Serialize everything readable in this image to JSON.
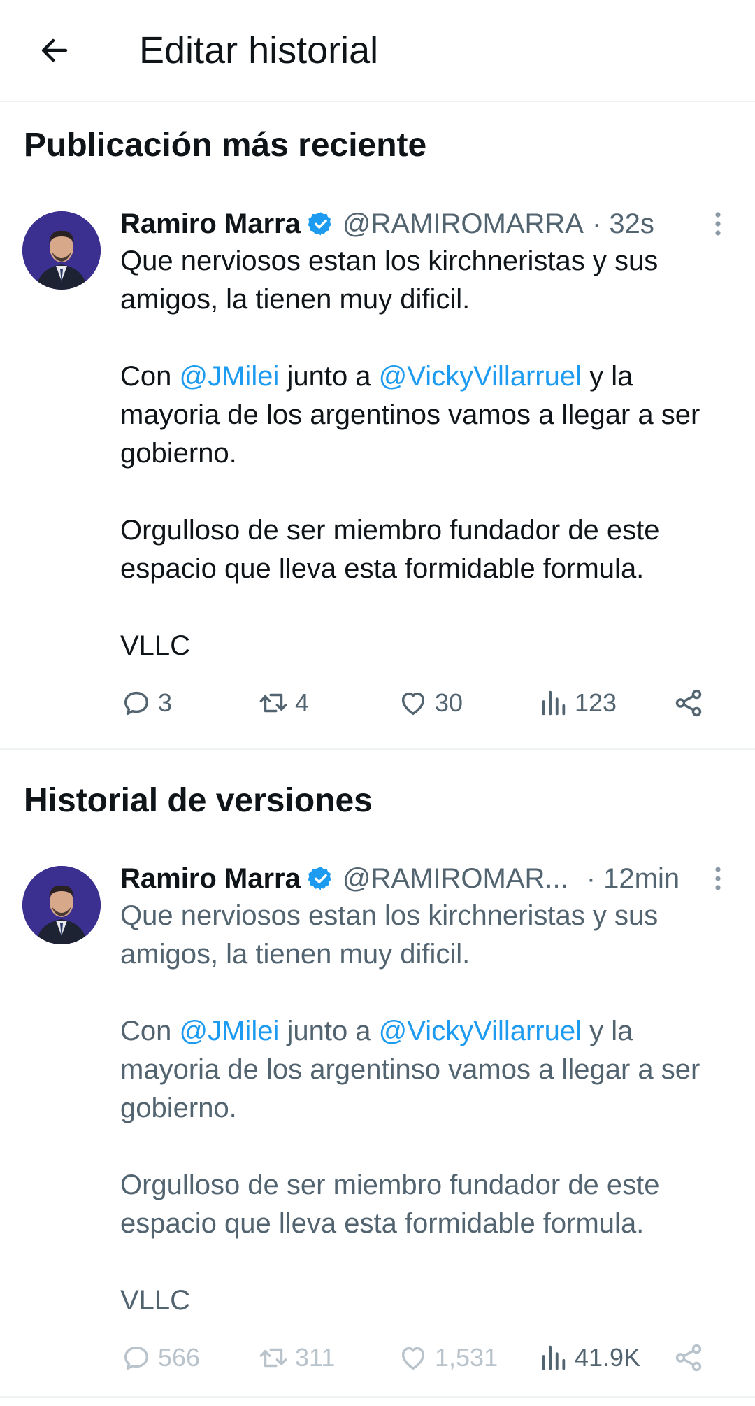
{
  "header": {
    "title": "Editar historial",
    "back_icon": "arrow-left-icon"
  },
  "sections": {
    "latest": "Publicación más reciente",
    "history": "Historial de versiones"
  },
  "posts": [
    {
      "author": "Ramiro Marra",
      "handle": "@RAMIROMARRA",
      "time": "· 32s",
      "lines": {
        "p1": "Que nerviosos estan los kirchneristas y sus amigos, la tienen muy dificil.",
        "p2_pre": "Con ",
        "mention1": "@JMilei",
        "p2_mid": " junto a ",
        "mention2": "@VickyVillarruel",
        "p2_post": " y la mayoria de los argentinos vamos a llegar a ser gobierno.",
        "p3": "Orgulloso de ser miembro fundador de este espacio que lleva esta formidable formula.",
        "p4": "VLLC"
      },
      "stats": {
        "replies": "3",
        "reposts": "4",
        "likes": "30",
        "views": "123"
      }
    },
    {
      "author": "Ramiro Marra",
      "handle": "@RAMIROMAR...",
      "time": "· 12min",
      "lines": {
        "p1": "Que nerviosos estan los kirchneristas y sus amigos, la tienen muy dificil.",
        "p2_pre": "Con ",
        "mention1": "@JMilei",
        "p2_mid": " junto a ",
        "mention2": "@VickyVillarruel",
        "p2_post": " y la mayoria de los argentinso vamos a llegar a ser gobierno.",
        "p3": "Orgulloso de ser miembro fundador de este espacio que lleva esta formidable formula.",
        "p4": "VLLC"
      },
      "stats": {
        "replies": "566",
        "reposts": "311",
        "likes": "1,531",
        "views": "41.9K"
      }
    }
  ],
  "colors": {
    "link": "#1d9bf0",
    "muted": "#536471",
    "verified": "#1d9bf0",
    "text": "#0f1419"
  }
}
